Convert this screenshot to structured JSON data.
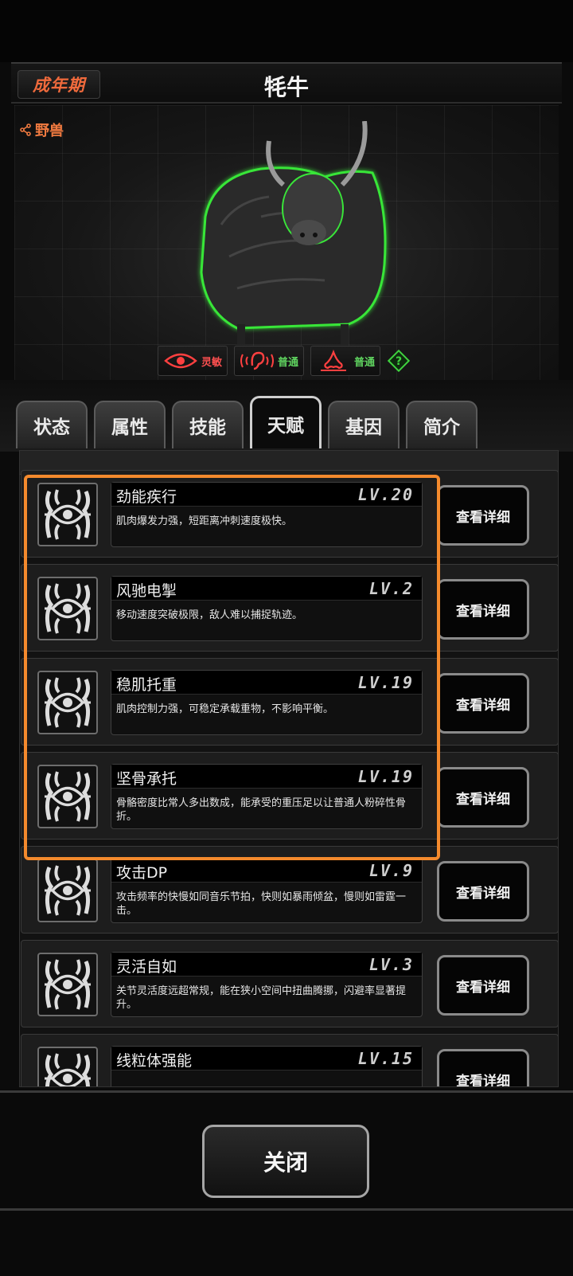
{
  "header": {
    "stage": "成年期",
    "title": "牦牛",
    "category": "野兽"
  },
  "senses": [
    {
      "icon": "eye-icon",
      "label": "灵敏",
      "color": "#ff5050"
    },
    {
      "icon": "ear-icon",
      "label": "普通",
      "color": "#5fd35f"
    },
    {
      "icon": "nose-icon",
      "label": "普通",
      "color": "#5fd35f"
    }
  ],
  "tabs": [
    "状态",
    "属性",
    "技能",
    "天赋",
    "基因",
    "简介"
  ],
  "active_tab": "天赋",
  "talents": [
    {
      "name": "劲能疾行",
      "level": "LV.20",
      "desc": "肌肉爆发力强，短距离冲刺速度极快。"
    },
    {
      "name": "风驰电掣",
      "level": "LV.2",
      "desc": "移动速度突破极限，敌人难以捕捉轨迹。"
    },
    {
      "name": "稳肌托重",
      "level": "LV.19",
      "desc": "肌肉控制力强，可稳定承载重物，不影响平衡。"
    },
    {
      "name": "坚骨承托",
      "level": "LV.19",
      "desc": "骨骼密度比常人多出数成，能承受的重压足以让普通人粉碎性骨折。"
    },
    {
      "name": "攻击DP",
      "level": "LV.9",
      "desc": "攻击频率的快慢如同音乐节拍，快则如暴雨倾盆，慢则如雷霆一击。"
    },
    {
      "name": "灵活自如",
      "level": "LV.3",
      "desc": "关节灵活度远超常规，能在狭小空间中扭曲腾挪，闪避率显著提升。"
    },
    {
      "name": "线粒体强能",
      "level": "LV.15",
      "desc": ""
    }
  ],
  "detail_label": "查看详细",
  "close_label": "关闭",
  "colors": {
    "accent_orange": "#f48a2d",
    "stage_red": "#f06a3c"
  }
}
